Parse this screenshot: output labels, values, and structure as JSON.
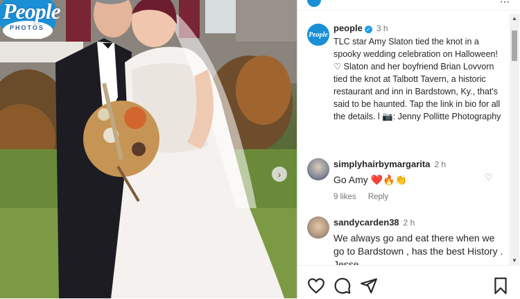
{
  "photo": {
    "logo_word": "People",
    "logo_sub": "PHOTOS",
    "next_glyph": "›"
  },
  "post": {
    "username": "people",
    "time": "3 h",
    "caption": "TLC star Amy Slaton tied the knot in a spooky wedding celebration on Halloween! ♡ Slaton and her boyfriend Brian Lovvorn tied the knot at Talbott Tavern, a historic restaurant and inn in Bardstown, Ky., that's said to be haunted. Tap the link in bio for all the details. l 📷: Jenny Pollitte Photography",
    "avatar_text": "People"
  },
  "comments": [
    {
      "username": "simplyhairbymargarita",
      "time": "2 h",
      "text": "Go Amy ❤️🔥👏",
      "likes": "9 likes",
      "reply": "Reply"
    },
    {
      "username": "sandycarden38",
      "time": "2 h",
      "text": "We always go and eat there when we go to Bardstown , has the best History . Jesse"
    }
  ],
  "icons": {
    "like": "heart-icon",
    "comment": "comment-icon",
    "share": "share-icon",
    "save": "bookmark-icon"
  },
  "colors": {
    "verified": "#1d9bf0",
    "people_brand": "#1a8fd6",
    "muted_text": "#737373"
  }
}
